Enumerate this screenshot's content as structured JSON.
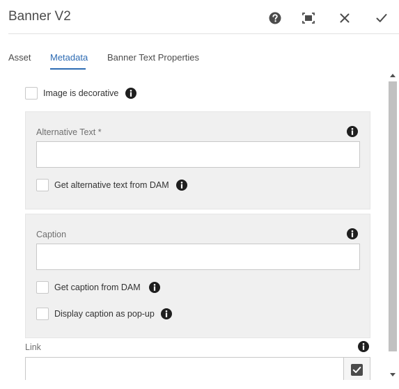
{
  "dialog": {
    "title": "Banner V2",
    "actions": {
      "help_icon": "help-icon",
      "fullscreen_icon": "fullscreen-icon",
      "close_icon": "close-icon",
      "done_icon": "checkmark-icon"
    }
  },
  "tabs": [
    {
      "label": "Asset",
      "active": false
    },
    {
      "label": "Metadata",
      "active": true
    },
    {
      "label": "Banner Text Properties",
      "active": false
    }
  ],
  "metadata": {
    "decorative": {
      "label": "Image is decorative",
      "checked": false
    },
    "alt_text": {
      "label": "Alternative Text *",
      "value": "",
      "from_dam": {
        "label": "Get alternative text from DAM",
        "checked": false
      }
    },
    "caption": {
      "label": "Caption",
      "value": "",
      "from_dam": {
        "label": "Get caption from DAM",
        "checked": false
      },
      "popup": {
        "label": "Display caption as pop-up",
        "checked": false
      }
    },
    "link": {
      "label": "Link",
      "value": ""
    }
  },
  "colors": {
    "accent": "#2d6bb3",
    "panel_bg": "#f0f0f0",
    "scroll_thumb": "#c1c1c1"
  }
}
